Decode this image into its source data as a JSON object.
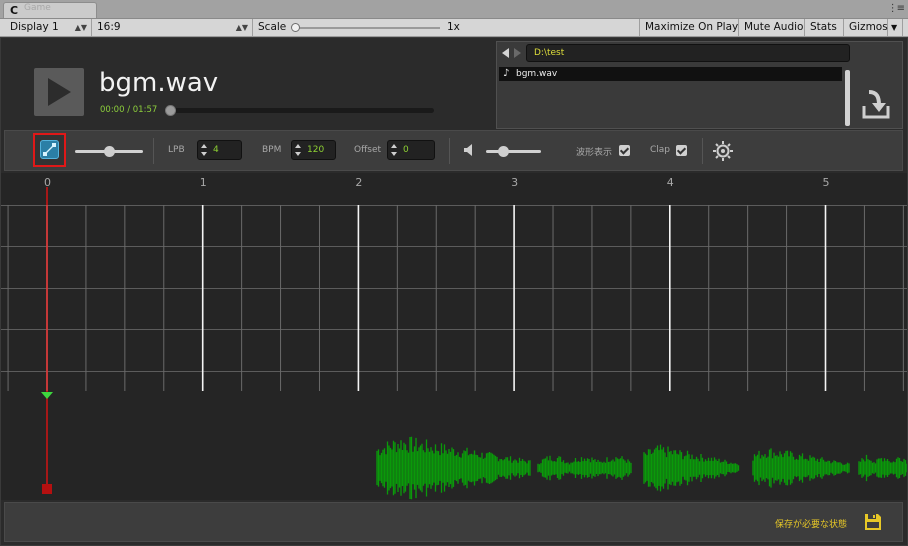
{
  "window": {
    "tab_icon": "unity-logo-icon",
    "tab_label": "Game",
    "tab_menu_glyph": "⋮≡"
  },
  "toolbar": {
    "display": "Display 1",
    "aspect": "16:9",
    "scale_label": "Scale",
    "scale_value": "1x",
    "maximize": "Maximize On Play",
    "mute": "Mute Audio",
    "stats": "Stats",
    "gizmos": "Gizmos"
  },
  "player": {
    "title": "bgm.wav",
    "time": "00:00 / 01:57",
    "progress": 0
  },
  "browser": {
    "path": "D:\\test",
    "files": [
      {
        "name": "bgm.wav",
        "icon": "music-note-icon"
      }
    ]
  },
  "controls": {
    "lpb_label": "LPB",
    "lpb_value": "4",
    "bpm_label": "BPM",
    "bpm_value": "120",
    "offset_label": "Offset",
    "offset_value": "0",
    "waveform_label": "波形表示",
    "waveform_checked": true,
    "clap_label": "Clap",
    "clap_checked": true,
    "zoom_level": 0.5,
    "volume_level": 0.3
  },
  "timeline": {
    "beat_numbers": [
      "0",
      "1",
      "2",
      "3",
      "4",
      "5"
    ],
    "lpb": 4,
    "playhead_beat": 0
  },
  "status": {
    "text": "保存が必要な状態"
  },
  "colors": {
    "accent_green": "#8ed133",
    "waveform": "#0a9a0a",
    "playhead": "#d11515",
    "status_yellow": "#e7c827"
  }
}
